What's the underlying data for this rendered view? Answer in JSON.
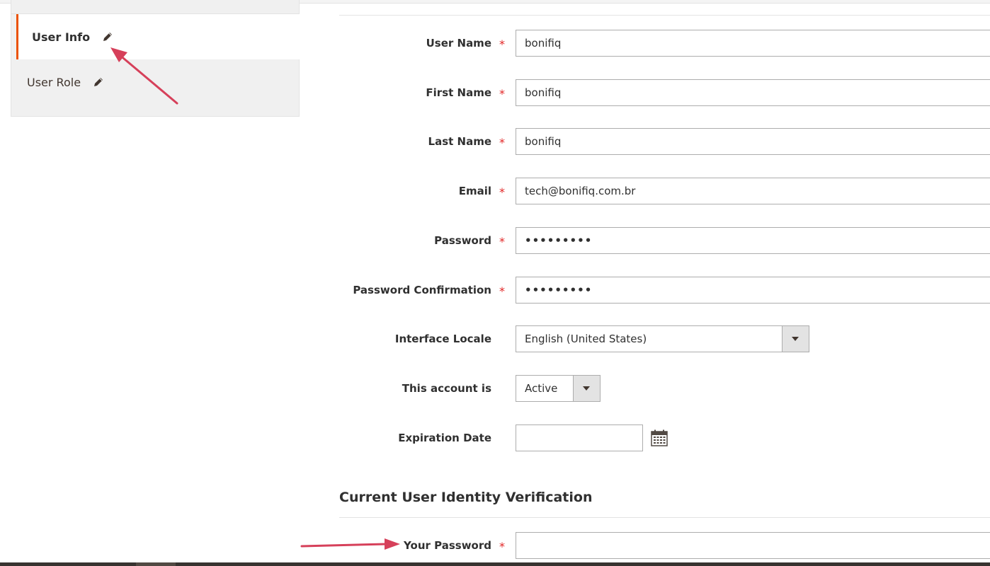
{
  "tabs": {
    "items": [
      {
        "label": "User Info",
        "active": true
      },
      {
        "label": "User Role",
        "active": false
      }
    ]
  },
  "form": {
    "required_mark": "*",
    "user_name": {
      "label": "User Name",
      "value": "bonifiq"
    },
    "first_name": {
      "label": "First Name",
      "value": "bonifiq"
    },
    "last_name": {
      "label": "Last Name",
      "value": "bonifiq"
    },
    "email": {
      "label": "Email",
      "value": "tech@bonifiq.com.br"
    },
    "password": {
      "label": "Password",
      "value": "•••••••••"
    },
    "password_confirmation": {
      "label": "Password Confirmation",
      "value": "•••••••••"
    },
    "interface_locale": {
      "label": "Interface Locale",
      "value": "English (United States)"
    },
    "account_status": {
      "label": "This account is",
      "value": "Active"
    },
    "expiration_date": {
      "label": "Expiration Date",
      "value": ""
    }
  },
  "verification": {
    "heading": "Current User Identity Verification",
    "your_password": {
      "label": "Your Password",
      "value": ""
    }
  },
  "colors": {
    "active_tab_accent": "#eb5202",
    "required_star": "#e22626",
    "annotation_arrow": "#d6405a"
  },
  "icons": {
    "edit": "pencil-icon",
    "calendar": "calendar-icon",
    "dropdown": "chevron-down-icon"
  }
}
